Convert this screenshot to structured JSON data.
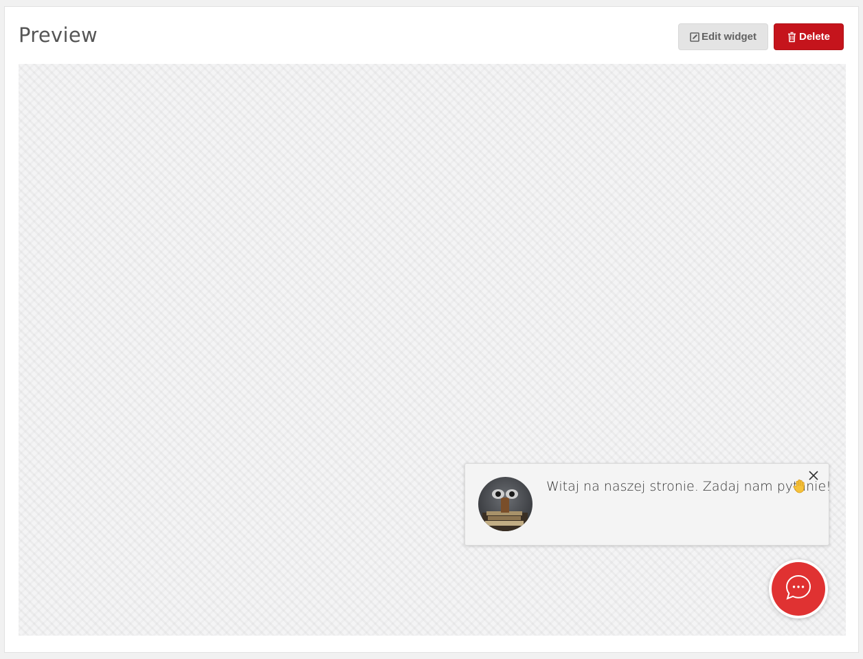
{
  "header": {
    "title": "Preview",
    "edit_label": "Edit widget",
    "delete_label": "Delete"
  },
  "widget": {
    "message": "Witaj na naszej stronie. Zadaj nam pytanie!",
    "emoji_icon": "raised-hand-emoji",
    "accent_color": "#e03232"
  },
  "colors": {
    "delete_button": "#c5141c",
    "edit_button": "#e4e4e4"
  }
}
